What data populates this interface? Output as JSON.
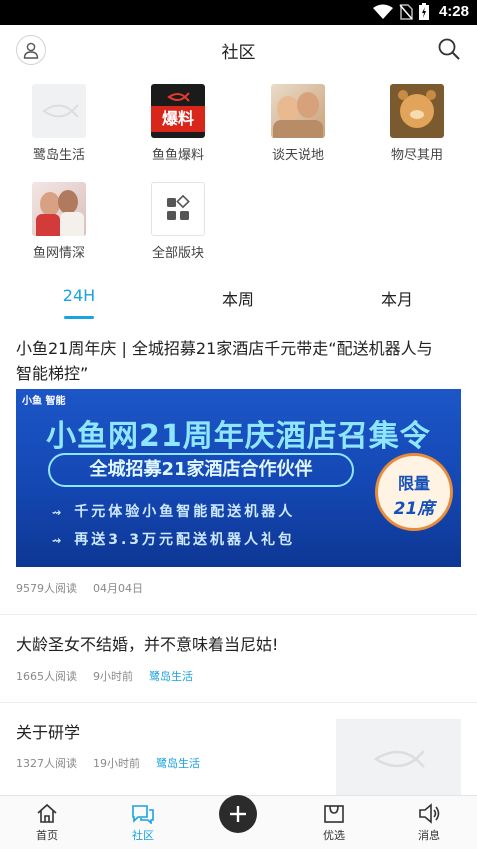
{
  "status_bar": {
    "time": "4:28"
  },
  "header": {
    "title": "社区"
  },
  "categories": [
    {
      "label": "鹭岛生活"
    },
    {
      "label": "鱼鱼爆料",
      "thumb_text": "爆料"
    },
    {
      "label": "谈天说地"
    },
    {
      "label": "物尽其用"
    },
    {
      "label": "鱼网情深"
    },
    {
      "label": "全部版块"
    }
  ],
  "tabs": [
    {
      "label": "24H",
      "active": true
    },
    {
      "label": "本周",
      "active": false
    },
    {
      "label": "本月",
      "active": false
    }
  ],
  "posts": [
    {
      "title_line1": "小鱼21周年庆 | 全城招募21家酒店千元带走“配送机器人与",
      "title_line2": "智能梯控”",
      "banner": {
        "brand": "小鱼 智能",
        "headline": "小鱼网21周年庆酒店召集令",
        "pill": "全城招募21家酒店合作伙伴",
        "line1": "千元体验小鱼智能配送机器人",
        "line2": "再送3.3万元配送机器人礼包",
        "badge_top": "限量",
        "badge_bottom": "21席"
      },
      "reads": "9579人阅读",
      "time": "04月04日"
    },
    {
      "title": "大龄圣女不结婚，并不意味着当尼姑!",
      "reads": "1665人阅读",
      "time": "9小时前",
      "tag": "鹭岛生活"
    },
    {
      "title": "关于研学",
      "reads": "1327人阅读",
      "time": "19小时前",
      "tag": "鹭岛生活"
    }
  ],
  "bottom_nav": [
    {
      "label": "首页",
      "icon": "home-icon"
    },
    {
      "label": "社区",
      "icon": "community-icon",
      "active": true
    },
    {
      "label": "",
      "icon": "plus-icon"
    },
    {
      "label": "优选",
      "icon": "bag-icon"
    },
    {
      "label": "消息",
      "icon": "speaker-icon"
    }
  ],
  "colors": {
    "accent": "#1aa3e0",
    "banner_blue": "#1447b3"
  }
}
